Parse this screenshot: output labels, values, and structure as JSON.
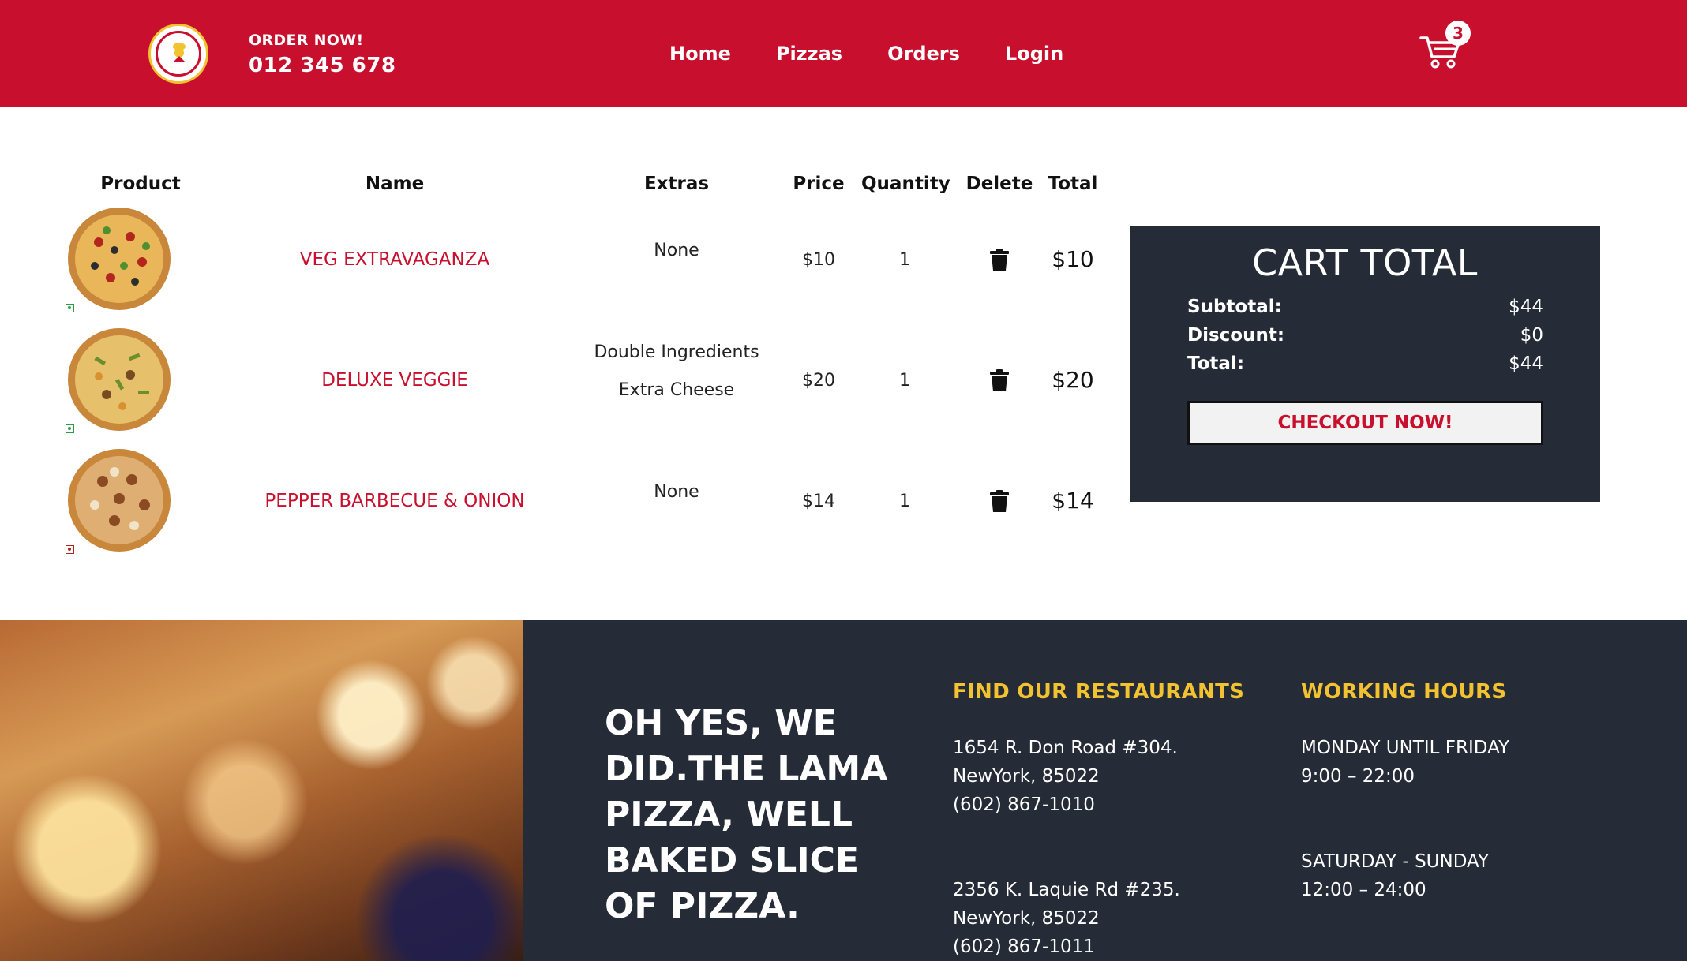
{
  "navbar": {
    "order_label": "ORDER NOW!",
    "phone": "012 345 678",
    "menu": [
      "Home",
      "Pizzas",
      "Orders",
      "Login"
    ],
    "cart_count": "3",
    "colors": {
      "brand": "#c8102e",
      "accent": "#f2c230"
    }
  },
  "cart_table": {
    "headers": [
      "Product",
      "Name",
      "Extras",
      "Price",
      "Quantity",
      "Delete",
      "Total"
    ],
    "rows": [
      {
        "name": "VEG EXTRAVAGANZA",
        "extras": [
          "None"
        ],
        "price": "$10",
        "quantity": "1",
        "total": "$10",
        "diet": "veg"
      },
      {
        "name": "DELUXE VEGGIE",
        "extras": [
          "Double Ingredients",
          "Extra Cheese"
        ],
        "price": "$20",
        "quantity": "1",
        "total": "$20",
        "diet": "veg"
      },
      {
        "name": "PEPPER BARBECUE & ONION",
        "extras": [
          "None"
        ],
        "price": "$14",
        "quantity": "1",
        "total": "$14",
        "diet": "non-veg"
      }
    ]
  },
  "cart_total": {
    "title": "CART TOTAL",
    "subtotal_label": "Subtotal:",
    "subtotal": "$44",
    "discount_label": "Discount:",
    "discount": "$0",
    "total_label": "Total:",
    "total": "$44",
    "checkout_label": "CHECKOUT NOW!"
  },
  "footer": {
    "slogan": "OH YES, WE DID.THE LAMA PIZZA, WELL BAKED SLICE OF PIZZA.",
    "restaurants_title": "FIND OUR RESTAURANTS",
    "restaurants": [
      {
        "line1": "1654 R. Don Road #304.",
        "line2": "NewYork, 85022",
        "phone": "(602) 867-1010"
      },
      {
        "line1": "2356 K. Laquie Rd #235.",
        "line2": "NewYork, 85022",
        "phone": "(602) 867-1011"
      }
    ],
    "hours_title": "WORKING HOURS",
    "hours": [
      {
        "days": "MONDAY UNTIL FRIDAY",
        "time": "9:00 – 22:00"
      },
      {
        "days": "SATURDAY - SUNDAY",
        "time": "12:00 – 24:00"
      }
    ]
  }
}
